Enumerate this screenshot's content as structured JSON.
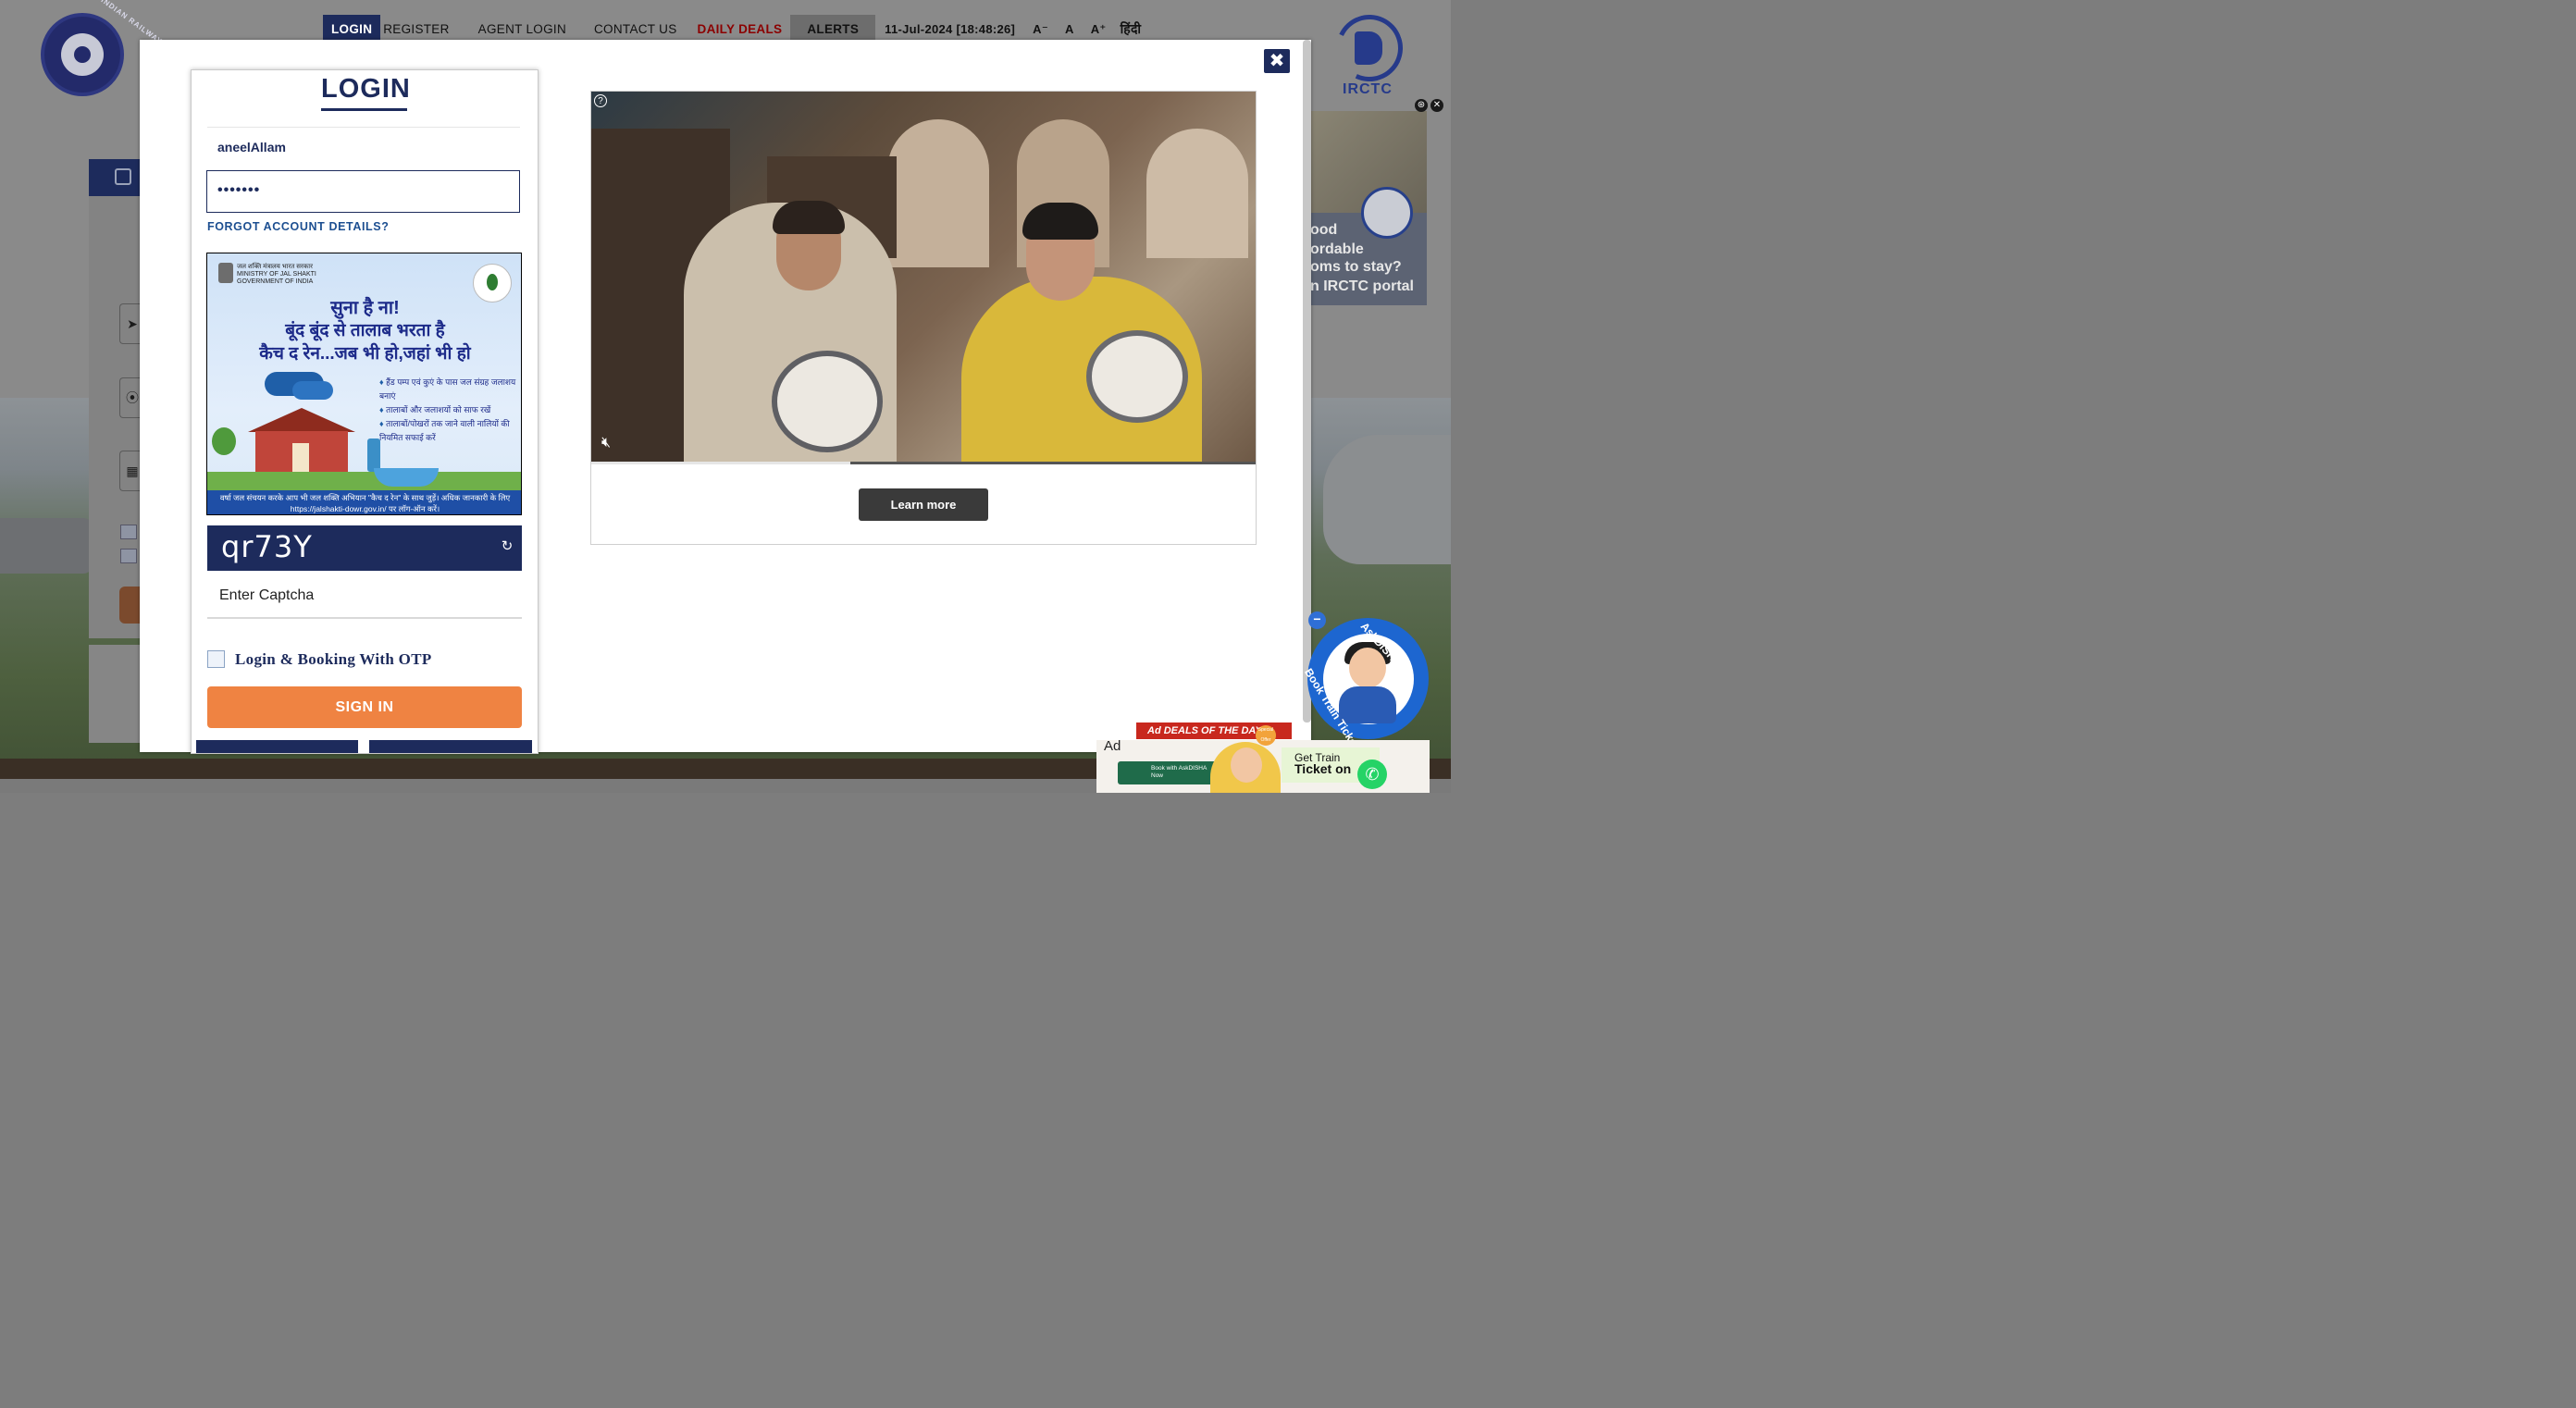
{
  "nav": {
    "login": "LOGIN",
    "register": "REGISTER",
    "agent_login": "AGENT LOGIN",
    "contact_us": "CONTACT US",
    "daily_deals": "DAILY DEALS",
    "alerts": "ALERTS",
    "datetime": "11-Jul-2024 [18:48:26]",
    "font_decrease": "A⁻",
    "font_normal": "A",
    "font_increase": "A⁺",
    "hindi": "हिंदी"
  },
  "logos": {
    "indian_railways_text": "INDIAN RAILWAYS",
    "irctc_text": "IRCTC"
  },
  "side_ad": {
    "lines": [
      "ood",
      "ordable",
      "oms to stay?",
      "n IRCTC portal"
    ]
  },
  "login_modal": {
    "title": "LOGIN",
    "username_value": "aneelAllam",
    "password_value": "•••••••",
    "forgot_link": "FORGOT ACCOUNT DETAILS?",
    "promo": {
      "ministry": "जल शक्ति मंत्रालय भारत सरकार MINISTRY OF JAL SHAKTI GOVERNMENT OF INDIA",
      "heading_1": "सुना है ना!",
      "heading_2": "बूंद बूंद से तालाब भरता है",
      "heading_3": "कैच द रेन...जब भी हो,जहां भी हो",
      "bullets": [
        "हैंड पम्प एवं कुएं के पास जल संग्रह जलाशय बनाएं",
        "तालाबों और जलाशयों को साफ रखें",
        "तालाबों/पोखरों तक जाने वाली नालियों की नियमित सफाई करें"
      ],
      "footer": "वर्षा जल संचयन करके आप भी जल शक्ति अभियान \"कैच द रेन\" के साथ जुड़ें। अधिक जानकारी के लिए https://jalshakti-dowr.gov.in/ पर लॉग-ऑन करें।"
    },
    "captcha_text": "qr73Y",
    "captcha_placeholder": "Enter Captcha",
    "otp_label": "Login & Booking With OTP",
    "signin_label": "SIGN IN",
    "close_icon": "✖"
  },
  "video_ad": {
    "learn_more": "Learn more",
    "help_icon": "?",
    "progress": 0.39
  },
  "widgets": {
    "askdisha_line1": "AskDISHA 2.0",
    "askdisha_line2": "Book Train Ticket",
    "ad_label": "Ad",
    "deals_ribbon": "Ad DEALS OF THE DAY",
    "special_offer": "Special Offer",
    "askdisha_pill": "Book with AskDISHA Now",
    "get_train": "Get Train",
    "ticket_on": "Ticket on"
  },
  "colors": {
    "brand_navy": "#1d2b5c",
    "signin_orange": "#ef8342",
    "deals_red": "#8b0000"
  }
}
